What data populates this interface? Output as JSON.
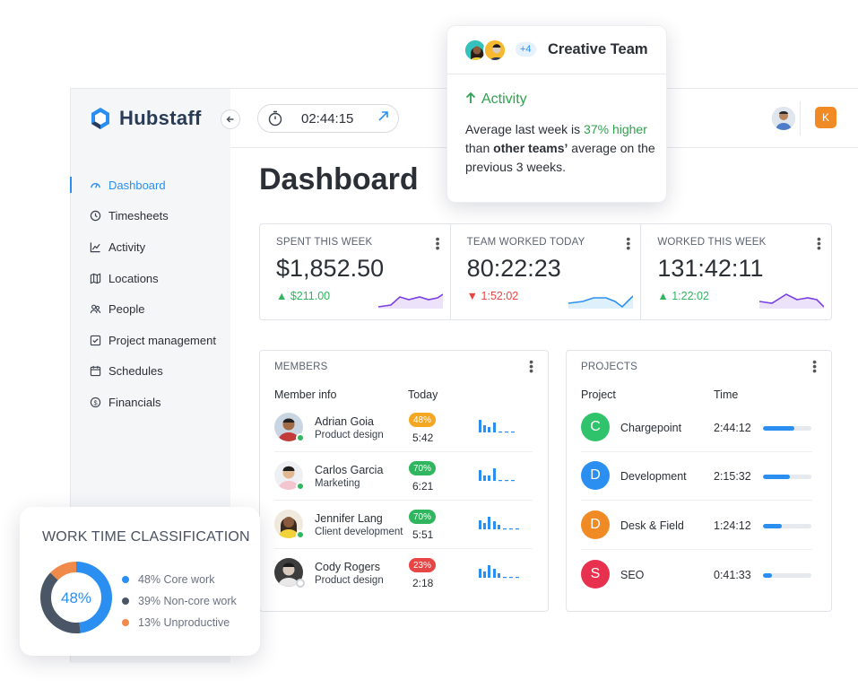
{
  "brand": {
    "name": "Hubstaff"
  },
  "timer": {
    "value": "02:44:15"
  },
  "user_badge": "K",
  "page_title": "Dashboard",
  "sidebar": {
    "items": [
      {
        "label": "Dashboard",
        "icon": "dashboard-icon",
        "active": true
      },
      {
        "label": "Timesheets",
        "icon": "clock-icon"
      },
      {
        "label": "Activity",
        "icon": "activity-chart-icon"
      },
      {
        "label": "Locations",
        "icon": "map-icon"
      },
      {
        "label": "People",
        "icon": "people-icon"
      },
      {
        "label": "Project management",
        "icon": "checkbox-icon"
      },
      {
        "label": "Schedules",
        "icon": "calendar-icon"
      },
      {
        "label": "Financials",
        "icon": "dollar-icon"
      }
    ]
  },
  "stats": [
    {
      "label": "SPENT THIS WEEK",
      "value": "$1,852.50",
      "delta": "$211.00",
      "direction": "up",
      "spark_color": "#7b3fe4"
    },
    {
      "label": "TEAM WORKED TODAY",
      "value": "80:22:23",
      "delta": "1:52:02",
      "direction": "down",
      "spark_color": "#2a8ff0"
    },
    {
      "label": "WORKED THIS WEEK",
      "value": "131:42:11",
      "delta": "1:22:02",
      "direction": "up",
      "spark_color": "#7b3fe4"
    }
  ],
  "members": {
    "title": "MEMBERS",
    "col_member": "Member info",
    "col_today": "Today",
    "rows": [
      {
        "name": "Adrian Goia",
        "role": "Product design",
        "pct": "48%",
        "pct_color": "#f5a623",
        "time": "5:42",
        "online": true
      },
      {
        "name": "Carlos Garcia",
        "role": "Marketing",
        "pct": "70%",
        "pct_color": "#2fb65e",
        "time": "6:21",
        "online": true
      },
      {
        "name": "Jennifer Lang",
        "role": "Client development",
        "pct": "70%",
        "pct_color": "#2fb65e",
        "time": "5:51",
        "online": true
      },
      {
        "name": "Cody Rogers",
        "role": "Product design",
        "pct": "23%",
        "pct_color": "#e84545",
        "time": "2:18",
        "online": false
      }
    ]
  },
  "projects": {
    "title": "PROJECTS",
    "col_project": "Project",
    "col_time": "Time",
    "rows": [
      {
        "letter": "C",
        "name": "Chargepoint",
        "time": "2:44:12",
        "color": "#2fc46b",
        "progress": 0.65
      },
      {
        "letter": "D",
        "name": "Development",
        "time": "2:15:32",
        "color": "#2a8ff0",
        "progress": 0.55
      },
      {
        "letter": "D",
        "name": "Desk & Field",
        "time": "1:24:12",
        "color": "#f08a24",
        "progress": 0.38
      },
      {
        "letter": "S",
        "name": "SEO",
        "time": "0:41:33",
        "color": "#e8304f",
        "progress": 0.18
      }
    ]
  },
  "popup": {
    "extra_count": "+4",
    "title": "Creative Team",
    "activity_label": "Activity",
    "text_1": "Average last week is ",
    "text_highlight": "37% higher",
    "text_2": " than ",
    "text_bold": "other teams’",
    "text_3": " average on the previous 3 weeks."
  },
  "work_time": {
    "title": "WORK TIME CLASSIFICATION",
    "center_label": "48%",
    "segments": [
      {
        "label": "48% Core work",
        "value": 48,
        "color": "#2a8ff0"
      },
      {
        "label": "39% Non-core work",
        "value": 39,
        "color": "#4a5566"
      },
      {
        "label": "13% Unproductive",
        "value": 13,
        "color": "#f08a4b"
      }
    ]
  }
}
